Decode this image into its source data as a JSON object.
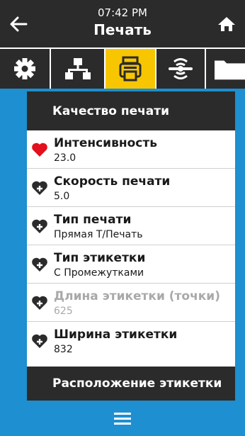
{
  "header": {
    "time": "07:42 PM",
    "title": "Печать"
  },
  "tabs": [
    {
      "name": "settings",
      "icon": "gear-icon"
    },
    {
      "name": "network",
      "icon": "network-icon"
    },
    {
      "name": "print",
      "icon": "printer-icon",
      "active": true
    },
    {
      "name": "connectivity",
      "icon": "wireless-icon"
    },
    {
      "name": "storage",
      "icon": "folder-icon"
    }
  ],
  "sections": {
    "print_quality": "Качество печати",
    "label_position": "Расположение этикетки"
  },
  "items": [
    {
      "label": "Интенсивность",
      "value": "23.0",
      "favorite": true
    },
    {
      "label": "Скорость печати",
      "value": "5.0",
      "favorite": false
    },
    {
      "label": "Тип печати",
      "value": "Прямая Т/Печать",
      "favorite": false
    },
    {
      "label": "Тип этикетки",
      "value": "С Промежутками",
      "favorite": false
    },
    {
      "label": "Длина этикетки (точки)",
      "value": "625",
      "favorite": false,
      "disabled": true
    },
    {
      "label": "Ширина этикетки",
      "value": "832",
      "favorite": false
    }
  ],
  "colors": {
    "accent": "#f7c600",
    "background": "#1e8fd0",
    "dark": "#2b2b2b",
    "favorite": "#e3101d"
  }
}
